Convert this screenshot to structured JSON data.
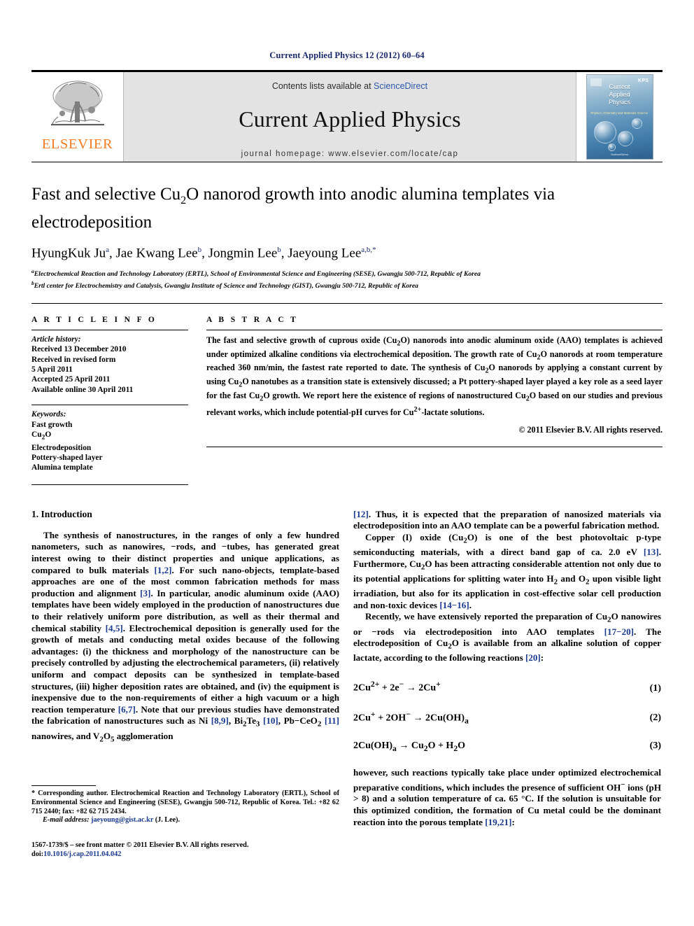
{
  "running_head": "Current Applied Physics 12 (2012) 60–64",
  "masthead": {
    "elsevier_wordmark": "ELSEVIER",
    "contents_prefix": "Contents lists available at ",
    "contents_link": "ScienceDirect",
    "journal_name": "Current Applied Physics",
    "homepage": "journal homepage: www.elsevier.com/locate/cap",
    "cover": {
      "title_line1": "Current",
      "title_line2": "Applied",
      "title_line3": "Physics",
      "subtitle": "Physics, Chemistry and Materials Science",
      "society_logo": "KPS",
      "publisher_foot": "ScienceDirect"
    }
  },
  "article": {
    "title": "Fast and selective Cu2O nanorod growth into anodic alumina templates via electrodeposition",
    "title_parts": {
      "before_sub": "Fast and selective Cu",
      "sub": "2",
      "after_sub": "O nanorod growth into anodic alumina templates via electrodeposition"
    },
    "authors": [
      {
        "name": "HyungKuk Ju",
        "marks": "a"
      },
      {
        "name": "Jae Kwang Lee",
        "marks": "b"
      },
      {
        "name": "Jongmin Lee",
        "marks": "b"
      },
      {
        "name": "Jaeyoung Lee",
        "marks": "a,b,*"
      }
    ],
    "affiliations": [
      {
        "mark": "a",
        "text": "Electrochemical Reaction and Technology Laboratory (ERTL), School of Environmental Science and Engineering (SESE), Gwangju 500-712, Republic of Korea"
      },
      {
        "mark": "b",
        "text": "Ertl center for Electrochemistry and Catalysis, Gwangju Institute of Science and Technology (GIST), Gwangju 500-712, Republic of Korea"
      }
    ]
  },
  "article_info": {
    "heading": "A R T I C L E   I N F O",
    "history_label": "Article history:",
    "history": [
      "Received 13 December 2010",
      "Received in revised form",
      "5 April 2011",
      "Accepted 25 April 2011",
      "Available online 30 April 2011"
    ],
    "keywords_label": "Keywords:",
    "keywords": [
      "Fast growth",
      "Cu2O",
      "Electrodeposition",
      "Pottery-shaped layer",
      "Alumina template"
    ]
  },
  "abstract": {
    "heading": "A B S T R A C T",
    "text": "The fast and selective growth of cuprous oxide (Cu2O) nanorods into anodic aluminum oxide (AAO) templates is achieved under optimized alkaline conditions via electrochemical deposition. The growth rate of Cu2O nanorods at room temperature reached 360 nm/min, the fastest rate reported to date. The synthesis of Cu2O nanorods by applying a constant current by using Cu2O nanotubes as a transition state is extensively discussed; a Pt pottery-shaped layer played a key role as a seed layer for the fast Cu2O growth. We report here the existence of regions of nanostructured Cu2O based on our studies and previous relevant works, which include potential-pH curves for Cu2+-lactate solutions.",
    "copyright": "© 2011 Elsevier B.V. All rights reserved."
  },
  "sections": {
    "intro_heading": "1. Introduction",
    "left_paragraphs": [
      "The synthesis of nanostructures, in the ranges of only a few hundred nanometers, such as nanowires, −rods, and −tubes, has generated great interest owing to their distinct properties and unique applications, as compared to bulk materials [1,2]. For such nano-objects, template-based approaches are one of the most common fabrication methods for mass production and alignment [3]. In particular, anodic aluminum oxide (AAO) templates have been widely employed in the production of nanostructures due to their relatively uniform pore distribution, as well as their thermal and chemical stability [4,5]. Electrochemical deposition is generally used for the growth of metals and conducting metal oxides because of the following advantages: (i) the thickness and morphology of the nanostructure can be precisely controlled by adjusting the electrochemical parameters, (ii) relatively uniform and compact deposits can be synthesized in template-based structures, (iii) higher deposition rates are obtained, and (iv) the equipment is inexpensive due to the non-requirements of either a high vacuum or a high reaction temperature [6,7]. Note that our previous studies have demonstrated the fabrication of nanostructures such as Ni [8,9], Bi2Te3 [10], Pb−CeO2 [11] nanowires, and V2O5 agglomeration"
    ],
    "right_paragraphs": [
      "[12]. Thus, it is expected that the preparation of nanosized materials via electrodeposition into an AAO template can be a powerful fabrication method.",
      "Copper (I) oxide (Cu2O) is one of the best photovoltaic p-type semiconducting materials, with a direct band gap of ca. 2.0 eV [13]. Furthermore, Cu2O has been attracting considerable attention not only due to its potential applications for splitting water into H2 and O2 upon visible light irradiation, but also for its application in cost-effective solar cell production and non-toxic devices [14−16].",
      "Recently, we have extensively reported the preparation of Cu2O nanowires or −rods via electrodeposition into AAO templates [17−20]. The electrodeposition of Cu2O is available from an alkaline solution of copper lactate, according to the following reactions [20]:"
    ],
    "right_paragraph_after_eqs": "however, such reactions typically take place under optimized electrochemical preparative conditions, which includes the presence of sufficient OH− ions (pH > 8) and a solution temperature of ca. 65 °C. If the solution is unsuitable for this optimized condition, the formation of Cu metal could be the dominant reaction into the porous template [19,21]:"
  },
  "equations": [
    {
      "body": "2Cu2+ + 2e− → 2Cu+",
      "number": "(1)"
    },
    {
      "body": "2Cu+ + 2OH− → 2Cu(OH)a",
      "number": "(2)"
    },
    {
      "body": "2Cu(OH)a → Cu2O + H2O",
      "number": "(3)"
    }
  ],
  "footnote": {
    "text": "* Corresponding author. Electrochemical Reaction and Technology Laboratory (ERTL), School of Environmental Science and Engineering (SESE), Gwangju 500-712, Republic of Korea. Tel.: +82 62 715 2440; fax: +82 62 715 2434.",
    "email_label": "E-mail address:",
    "email": "jaeyoung@gist.ac.kr",
    "email_suffix": "(J. Lee)."
  },
  "footer": {
    "issn_line": "1567-1739/$ – see front matter © 2011 Elsevier B.V. All rights reserved.",
    "doi_prefix": "doi:",
    "doi": "10.1016/j.cap.2011.04.042"
  },
  "colors": {
    "link": "#1a3a8f",
    "running_head": "#1a2a6c",
    "elsevier_orange": "#f47c20",
    "masthead_gray": "#e3e3e3"
  }
}
